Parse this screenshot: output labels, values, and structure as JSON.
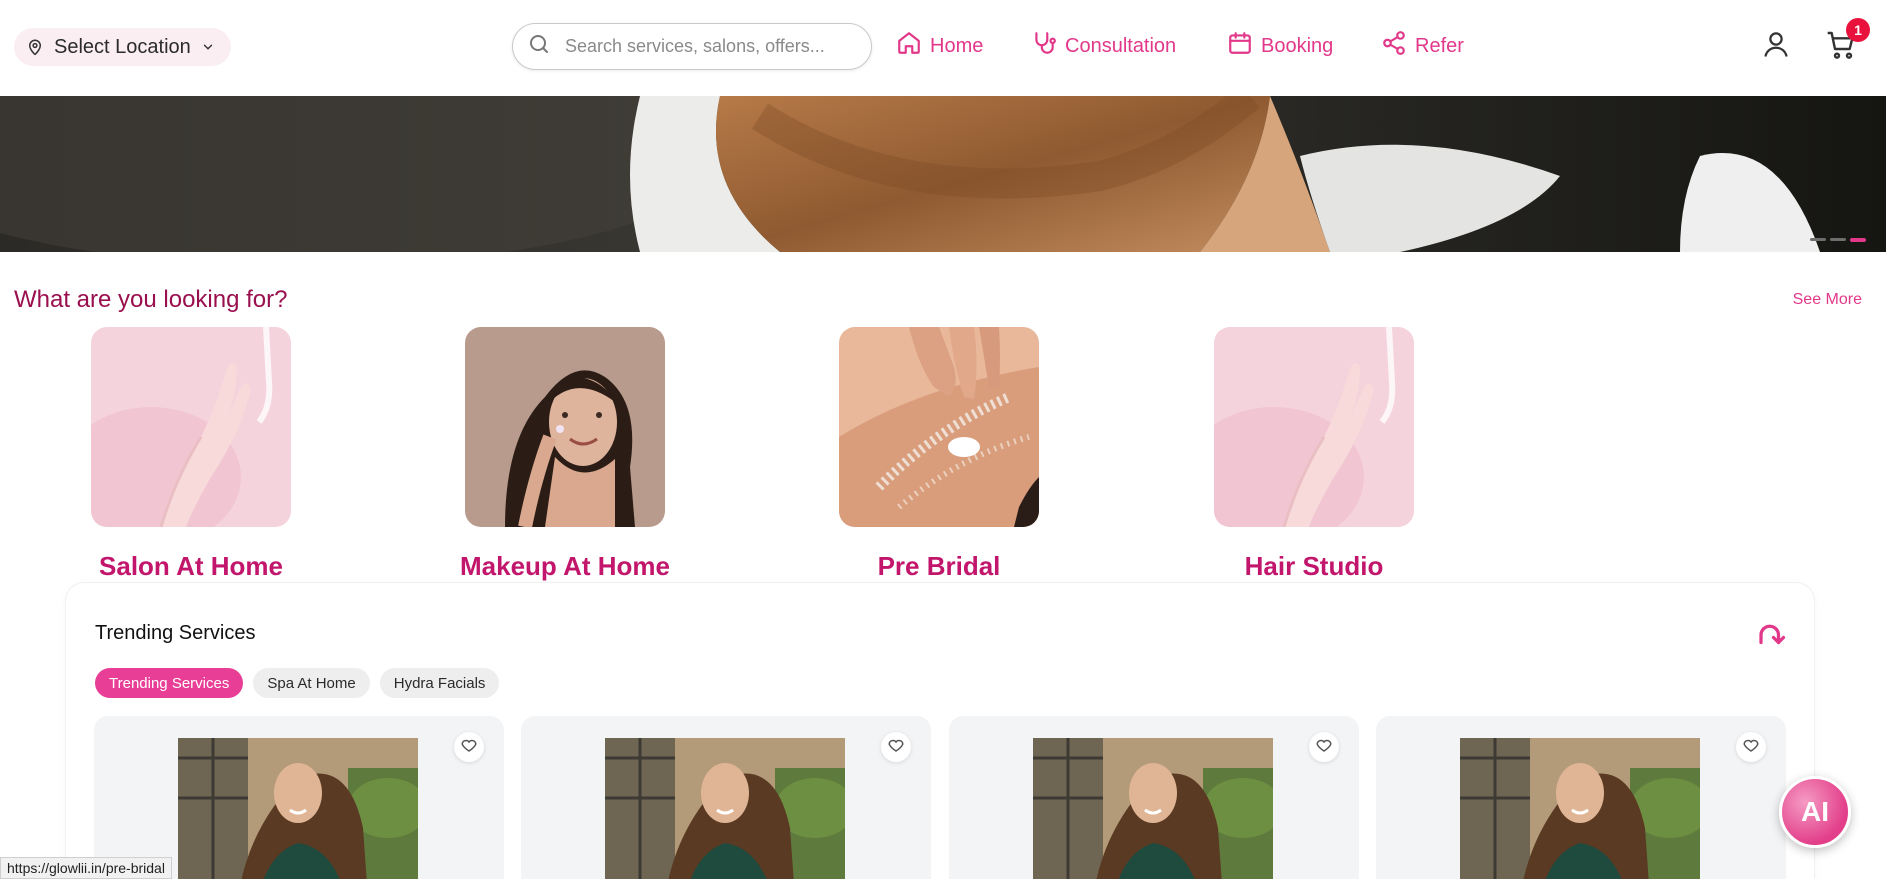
{
  "header": {
    "location_label": "Select Location",
    "search_placeholder": "Search services, salons, offers...",
    "nav": [
      {
        "label": "Home",
        "icon": "home-icon"
      },
      {
        "label": "Consultation",
        "icon": "stethoscope-icon"
      },
      {
        "label": "Booking",
        "icon": "calendar-icon"
      },
      {
        "label": "Refer",
        "icon": "share-icon"
      }
    ],
    "cart_count": "1"
  },
  "looking_for": {
    "title": "What are you looking for?",
    "see_more": "See More",
    "categories": [
      {
        "label": "Salon At Home"
      },
      {
        "label": "Makeup At Home"
      },
      {
        "label": "Pre Bridal"
      },
      {
        "label": "Hair Studio"
      }
    ]
  },
  "trending": {
    "title": "Trending Services",
    "tabs": [
      "Trending Services",
      "Spa At Home",
      "Hydra Facials"
    ],
    "active_tab": 0
  },
  "ai_button_label": "AI",
  "status_url": "https://glowlii.in/pre-bridal",
  "colors": {
    "brand_pink": "#e2388a",
    "title_maroon": "#9a0f4e",
    "category_pink": "#c2166c",
    "badge_red": "#e8123c"
  }
}
